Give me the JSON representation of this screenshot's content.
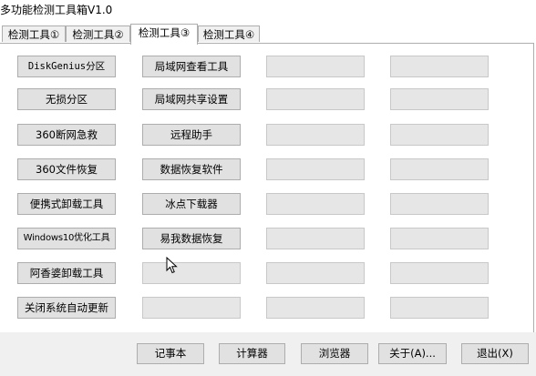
{
  "window": {
    "title": "多功能检测工具箱V1.0"
  },
  "tabs": [
    {
      "label": "检测工具①",
      "active": false
    },
    {
      "label": "检测工具②",
      "active": false
    },
    {
      "label": "检测工具③",
      "active": true
    },
    {
      "label": "检测工具④",
      "active": false
    }
  ],
  "column1": [
    "DiskGenius分区",
    "无损分区",
    "360断网急救",
    "360文件恢复",
    "便携式卸载工具",
    "Windows10优化工具",
    "阿香婆卸载工具",
    "关闭系统自动更新"
  ],
  "column2": [
    "局域网查看工具",
    "局域网共享设置",
    "远程助手",
    "数据恢复软件",
    "冰点下载器",
    "易我数据恢复",
    "",
    ""
  ],
  "bottom_buttons": [
    "记事本",
    "计算器",
    "浏览器",
    "关于(A)...",
    "退出(X)"
  ],
  "icons": {
    "cursor": "mouse-pointer-icon"
  }
}
